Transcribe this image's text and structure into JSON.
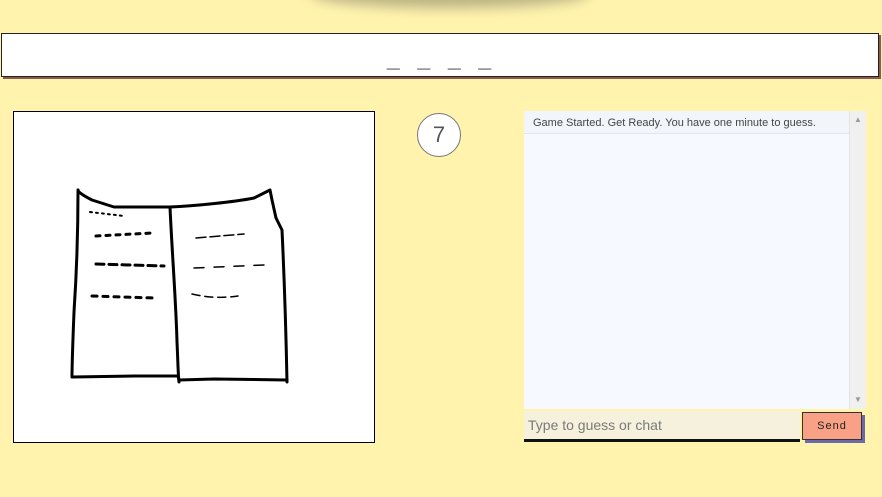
{
  "game": {
    "word_hint": "_ _ _ _",
    "timer": "7"
  },
  "chat": {
    "messages": [
      "Game Started. Get Ready. You have one minute to guess."
    ],
    "input_placeholder": "Type to guess or chat",
    "input_value": "",
    "send_label": "Send"
  },
  "colors": {
    "background": "#fff3ad",
    "send_button": "#f9a187",
    "chat_background": "#f6f9ff"
  },
  "icons": {
    "scroll_up": "scroll-up-icon",
    "scroll_down": "scroll-down-icon"
  }
}
